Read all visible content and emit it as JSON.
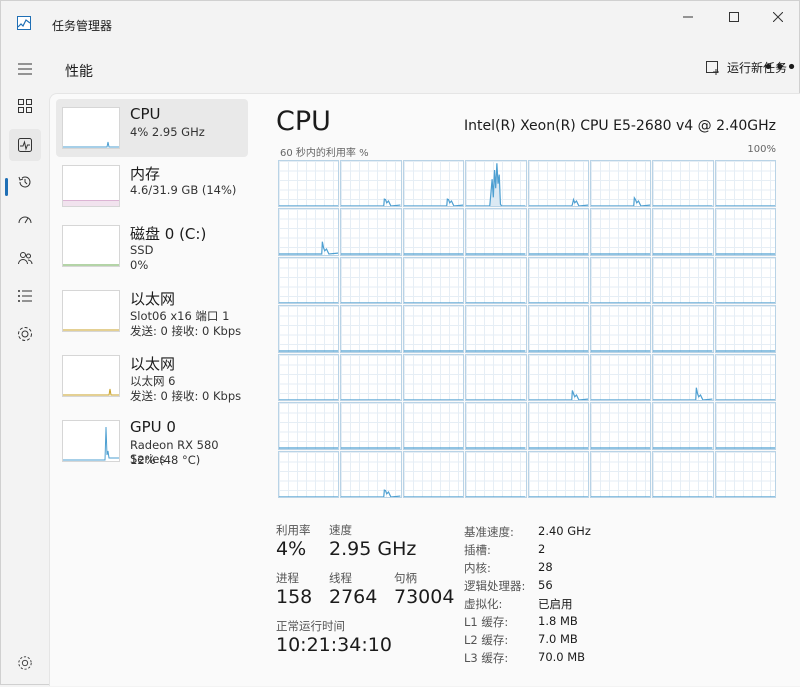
{
  "app": {
    "title": "任务管理器"
  },
  "header": {
    "page_title": "性能",
    "run_task_label": "运行新任务",
    "more_label": "•••"
  },
  "nav": [
    {
      "icon": "hamburger-menu-icon"
    },
    {
      "icon": "processes-icon"
    },
    {
      "icon": "performance-icon",
      "active": true
    },
    {
      "icon": "app-history-icon"
    },
    {
      "icon": "startup-apps-icon"
    },
    {
      "icon": "users-icon"
    },
    {
      "icon": "details-icon"
    },
    {
      "icon": "services-icon"
    },
    {
      "icon": "settings-gear-icon"
    }
  ],
  "perf_items": [
    {
      "title": "CPU",
      "line1": "4%  2.95 GHz",
      "line2": ""
    },
    {
      "title": "内存",
      "line1": "4.6/31.9 GB (14%)",
      "line2": ""
    },
    {
      "title": "磁盘 0 (C:)",
      "line1": "SSD",
      "line2": "0%"
    },
    {
      "title": "以太网",
      "line1": "Slot06 x16 端口 1",
      "line2": "发送: 0 接收: 0 Kbps"
    },
    {
      "title": "以太网",
      "line1": "以太网 6",
      "line2": "发送: 0 接收: 0 Kbps"
    },
    {
      "title": "GPU 0",
      "line1": "Radeon RX 580 Series",
      "line2": "12% (48 °C)"
    }
  ],
  "detail": {
    "title": "CPU",
    "model": "Intel(R) Xeon(R) CPU E5-2680 v4 @ 2.40GHz",
    "graph_label": "60 秒内的利用率 %",
    "graph_max": "100%",
    "stats": {
      "util_label": "利用率",
      "util_value": "4%",
      "speed_label": "速度",
      "speed_value": "2.95 GHz",
      "proc_label": "进程",
      "proc_value": "158",
      "threads_label": "线程",
      "threads_value": "2764",
      "handles_label": "句柄",
      "handles_value": "73004",
      "uptime_label": "正常运行时间",
      "uptime_value": "10:21:34:10"
    },
    "specs": [
      {
        "label": "基准速度:",
        "value": "2.40 GHz"
      },
      {
        "label": "插槽:",
        "value": "2"
      },
      {
        "label": "内核:",
        "value": "28"
      },
      {
        "label": "逻辑处理器:",
        "value": "56"
      },
      {
        "label": "虚拟化:",
        "value": "已启用"
      },
      {
        "label": "L1 缓存:",
        "value": "1.8 MB"
      },
      {
        "label": "L2 缓存:",
        "value": "7.0 MB"
      },
      {
        "label": "L3 缓存:",
        "value": "70.0 MB"
      }
    ]
  },
  "colors": {
    "accent": "#1f6fb5",
    "graph_line": "#4d9fd1",
    "graph_border": "#b9d3e6"
  }
}
